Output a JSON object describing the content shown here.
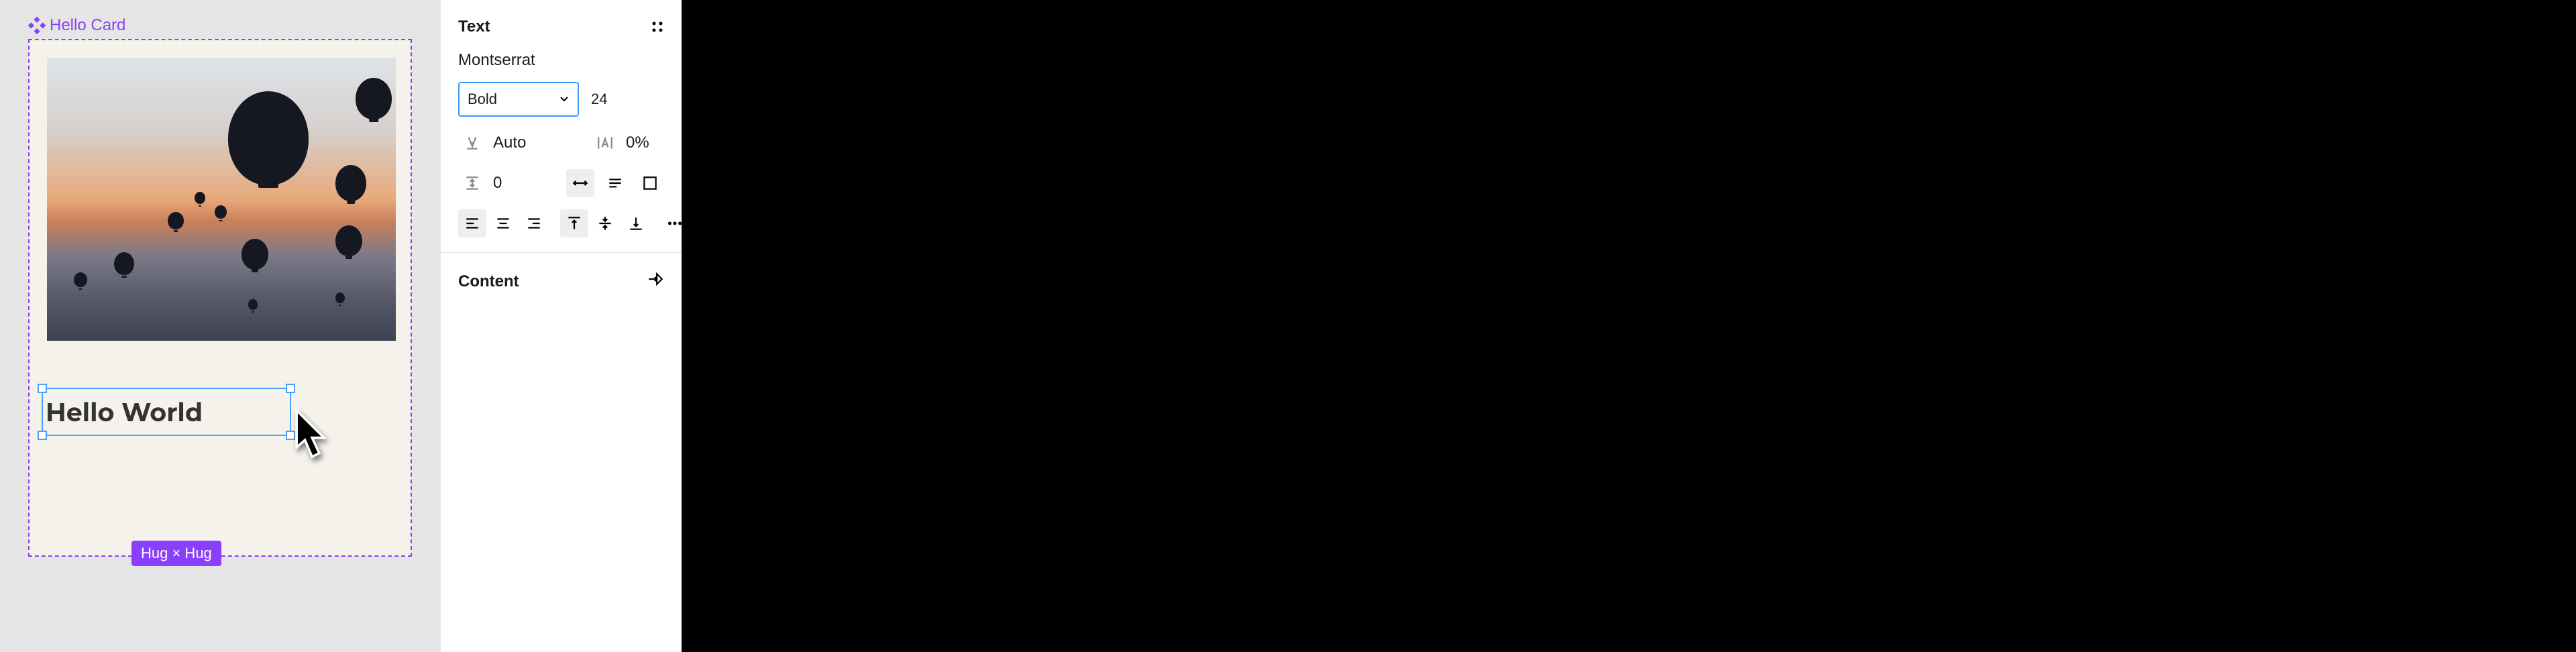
{
  "canvas": {
    "component_label": "Hello Card",
    "text_value": "Hello World",
    "size_badge": "Hug × Hug"
  },
  "inspector": {
    "text_section_title": "Text",
    "font_family": "Montserrat",
    "font_weight": "Bold",
    "font_size": "24",
    "line_height_label": "Auto",
    "letter_spacing": "0%",
    "paragraph_spacing": "0",
    "content_section_title": "Content"
  }
}
